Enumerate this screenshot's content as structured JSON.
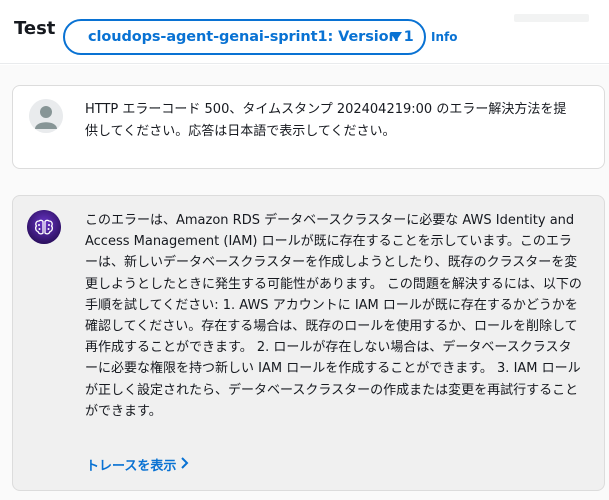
{
  "header": {
    "title": "Test",
    "version_label": "cloudops-agent-genai-sprint1: Version 1",
    "info_label": "Info"
  },
  "messages": {
    "user": {
      "text": "HTTP エラーコード 500、タイムスタンプ 202404219:00 のエラー解決方法を提供してください。応答は日本語で表示してください。"
    },
    "bot": {
      "text": "このエラーは、Amazon RDS データベースクラスターに必要な AWS Identity and Access Management (IAM) ロールが既に存在することを示しています。このエラーは、新しいデータベースクラスターを作成しようとしたり、既存のクラスターを変更しようとしたときに発生する可能性があります。 この問題を解決するには、以下の手順を試してください: 1. AWS アカウントに IAM ロールが既に存在するかどうかを確認してください。存在する場合は、既存のロールを使用するか、ロールを削除して再作成することができます。 2. ロールが存在しない場合は、データベースクラスターに必要な権限を持つ新しい IAM ロールを作成することができます。 3. IAM ロールが正しく設定されたら、データベースクラスターの作成または変更を再試行することができます。",
      "trace_label": "トレースを表示"
    }
  },
  "colors": {
    "accent": "#0972d3",
    "bot_avatar_bg": "#3b1a7a",
    "card_border": "#dcdcdc"
  },
  "icons": {
    "user_avatar": "user-avatar-icon",
    "bot_avatar": "ai-brain-icon",
    "caret": "caret-down-icon",
    "trace_chevron": "chevron-right-icon"
  }
}
